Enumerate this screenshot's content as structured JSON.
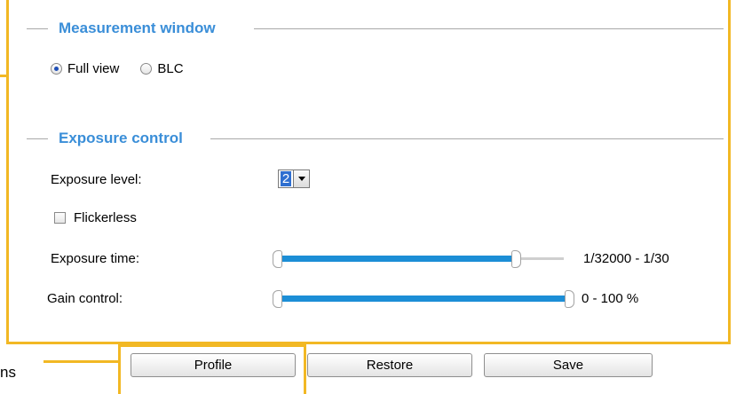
{
  "measurement": {
    "title": "Measurement window",
    "options": [
      {
        "label": "Full view",
        "checked": true
      },
      {
        "label": "BLC",
        "checked": false
      }
    ]
  },
  "exposure": {
    "title": "Exposure control",
    "level_label": "Exposure level:",
    "level_value": "2",
    "flickerless_label": "Flickerless",
    "flickerless_checked": false,
    "time_label": "Exposure time:",
    "time_value": "1/32000 - 1/30",
    "time_range_fraction": [
      0.0,
      0.85
    ],
    "gain_label": "Gain control:",
    "gain_value": "0 - 100 %",
    "gain_range_fraction": [
      0.0,
      1.0
    ]
  },
  "buttons": {
    "profile": "Profile",
    "restore": "Restore",
    "save": "Save"
  },
  "callout": {
    "text": "ns"
  },
  "colors": {
    "accent": "#3a8ed8",
    "highlight_frame": "#f2b824",
    "slider_fill": "#1c8ed6"
  }
}
